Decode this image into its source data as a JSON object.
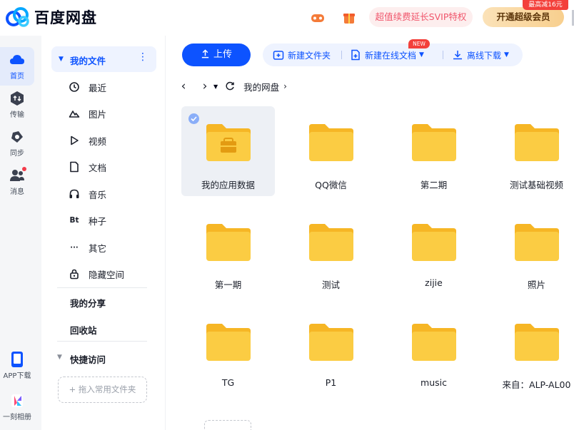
{
  "app": {
    "name": "百度网盘",
    "colors": {
      "brand": "#0d53ff",
      "folder": "#f9c93f",
      "promo_text": "#f0566c",
      "vip_text": "#5b3409"
    }
  },
  "header": {
    "icons": [
      "game-icon",
      "gift-icon"
    ],
    "promo_label": "超值续费延长SVIP特权",
    "vip_button_label": "开通超级会员",
    "vip_tag_label": "最高减16元"
  },
  "rail": {
    "items": [
      {
        "label": "首页",
        "icon": "home-cloud-icon",
        "active": true
      },
      {
        "label": "传输",
        "icon": "transfer-icon"
      },
      {
        "label": "同步",
        "icon": "sync-icon"
      },
      {
        "label": "消息",
        "icon": "message-icon",
        "badge": true
      },
      {
        "label": "APP下载",
        "icon": "phone-icon"
      },
      {
        "label": "一刻相册",
        "icon": "album-icon"
      }
    ]
  },
  "sidebar": {
    "my_files": "我的文件",
    "items": [
      {
        "label": "最近",
        "icon": "clock-icon"
      },
      {
        "label": "图片",
        "icon": "image-icon"
      },
      {
        "label": "视频",
        "icon": "play-icon"
      },
      {
        "label": "文档",
        "icon": "document-icon"
      },
      {
        "label": "音乐",
        "icon": "headphones-icon"
      },
      {
        "label": "种子",
        "icon_text": "Bt"
      },
      {
        "label": "其它",
        "icon_text": "···"
      },
      {
        "label": "隐藏空间",
        "icon": "lock-icon"
      }
    ],
    "my_share": "我的分享",
    "recycle_bin": "回收站",
    "quick_access": "快捷访问",
    "drop_placeholder": "+ 拖入常用文件夹"
  },
  "toolbar": {
    "upload_label": "上传",
    "new_folder_label": "新建文件夹",
    "new_online_doc_label": "新建在线文档",
    "new_badge": "NEW",
    "offline_download_label": "离线下载"
  },
  "breadcrumb": {
    "path": "我的网盘"
  },
  "files": [
    {
      "name": "我的应用数据",
      "selected": true,
      "special": "app-data"
    },
    {
      "name": "QQ微信"
    },
    {
      "name": "第二期"
    },
    {
      "name": "测试基础视频"
    },
    {
      "name": "第一期"
    },
    {
      "name": "测试"
    },
    {
      "name": "zijie"
    },
    {
      "name": "照片"
    },
    {
      "name": "TG"
    },
    {
      "name": "P1"
    },
    {
      "name": "music"
    },
    {
      "name": "来自：ALP-AL00"
    }
  ]
}
